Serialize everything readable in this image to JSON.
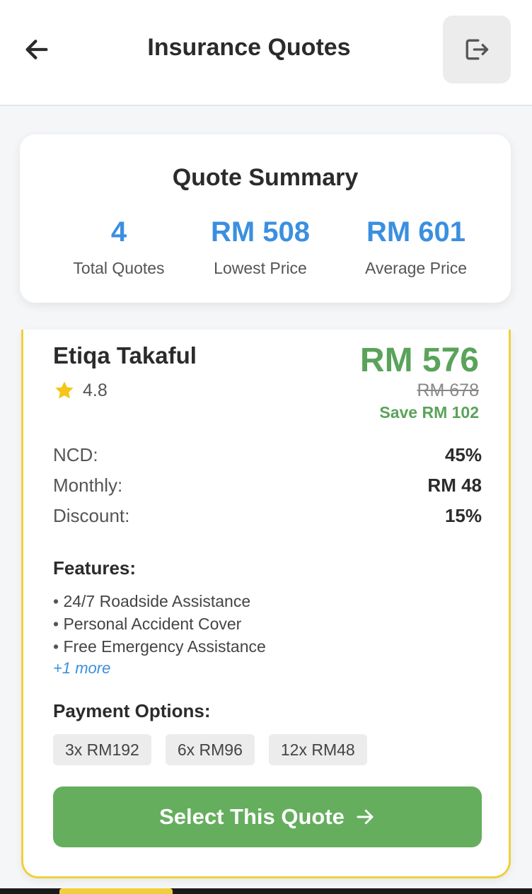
{
  "header": {
    "title": "Insurance Quotes",
    "back_icon": "arrow-left-icon",
    "logout_icon": "logout-icon"
  },
  "summary": {
    "title": "Quote Summary",
    "stats": [
      {
        "value": "4",
        "label": "Total Quotes"
      },
      {
        "value": "RM 508",
        "label": "Lowest Price"
      },
      {
        "value": "RM 601",
        "label": "Average Price"
      }
    ]
  },
  "quote": {
    "insurer": "Etiqa Takaful",
    "rating": "4.8",
    "price": "RM 576",
    "original_price": "RM 678",
    "savings": "Save RM 102",
    "details": [
      {
        "label": "NCD:",
        "value": "45%"
      },
      {
        "label": "Monthly:",
        "value": "RM 48"
      },
      {
        "label": "Discount:",
        "value": "15%"
      }
    ],
    "features_title": "Features:",
    "features": [
      "24/7 Roadside Assistance",
      "Personal Accident Cover",
      "Free Emergency Assistance"
    ],
    "more_features": "+1 more",
    "payment_title": "Payment Options:",
    "payment_options": [
      "3x RM192",
      "6x RM96",
      "12x RM48"
    ],
    "select_label": "Select This Quote"
  },
  "colors": {
    "accent_blue": "#3b8fe0",
    "price_green": "#5aa35a",
    "button_green": "#65ae5d",
    "highlight_border": "#f1cf3c",
    "star": "#f5c518"
  }
}
